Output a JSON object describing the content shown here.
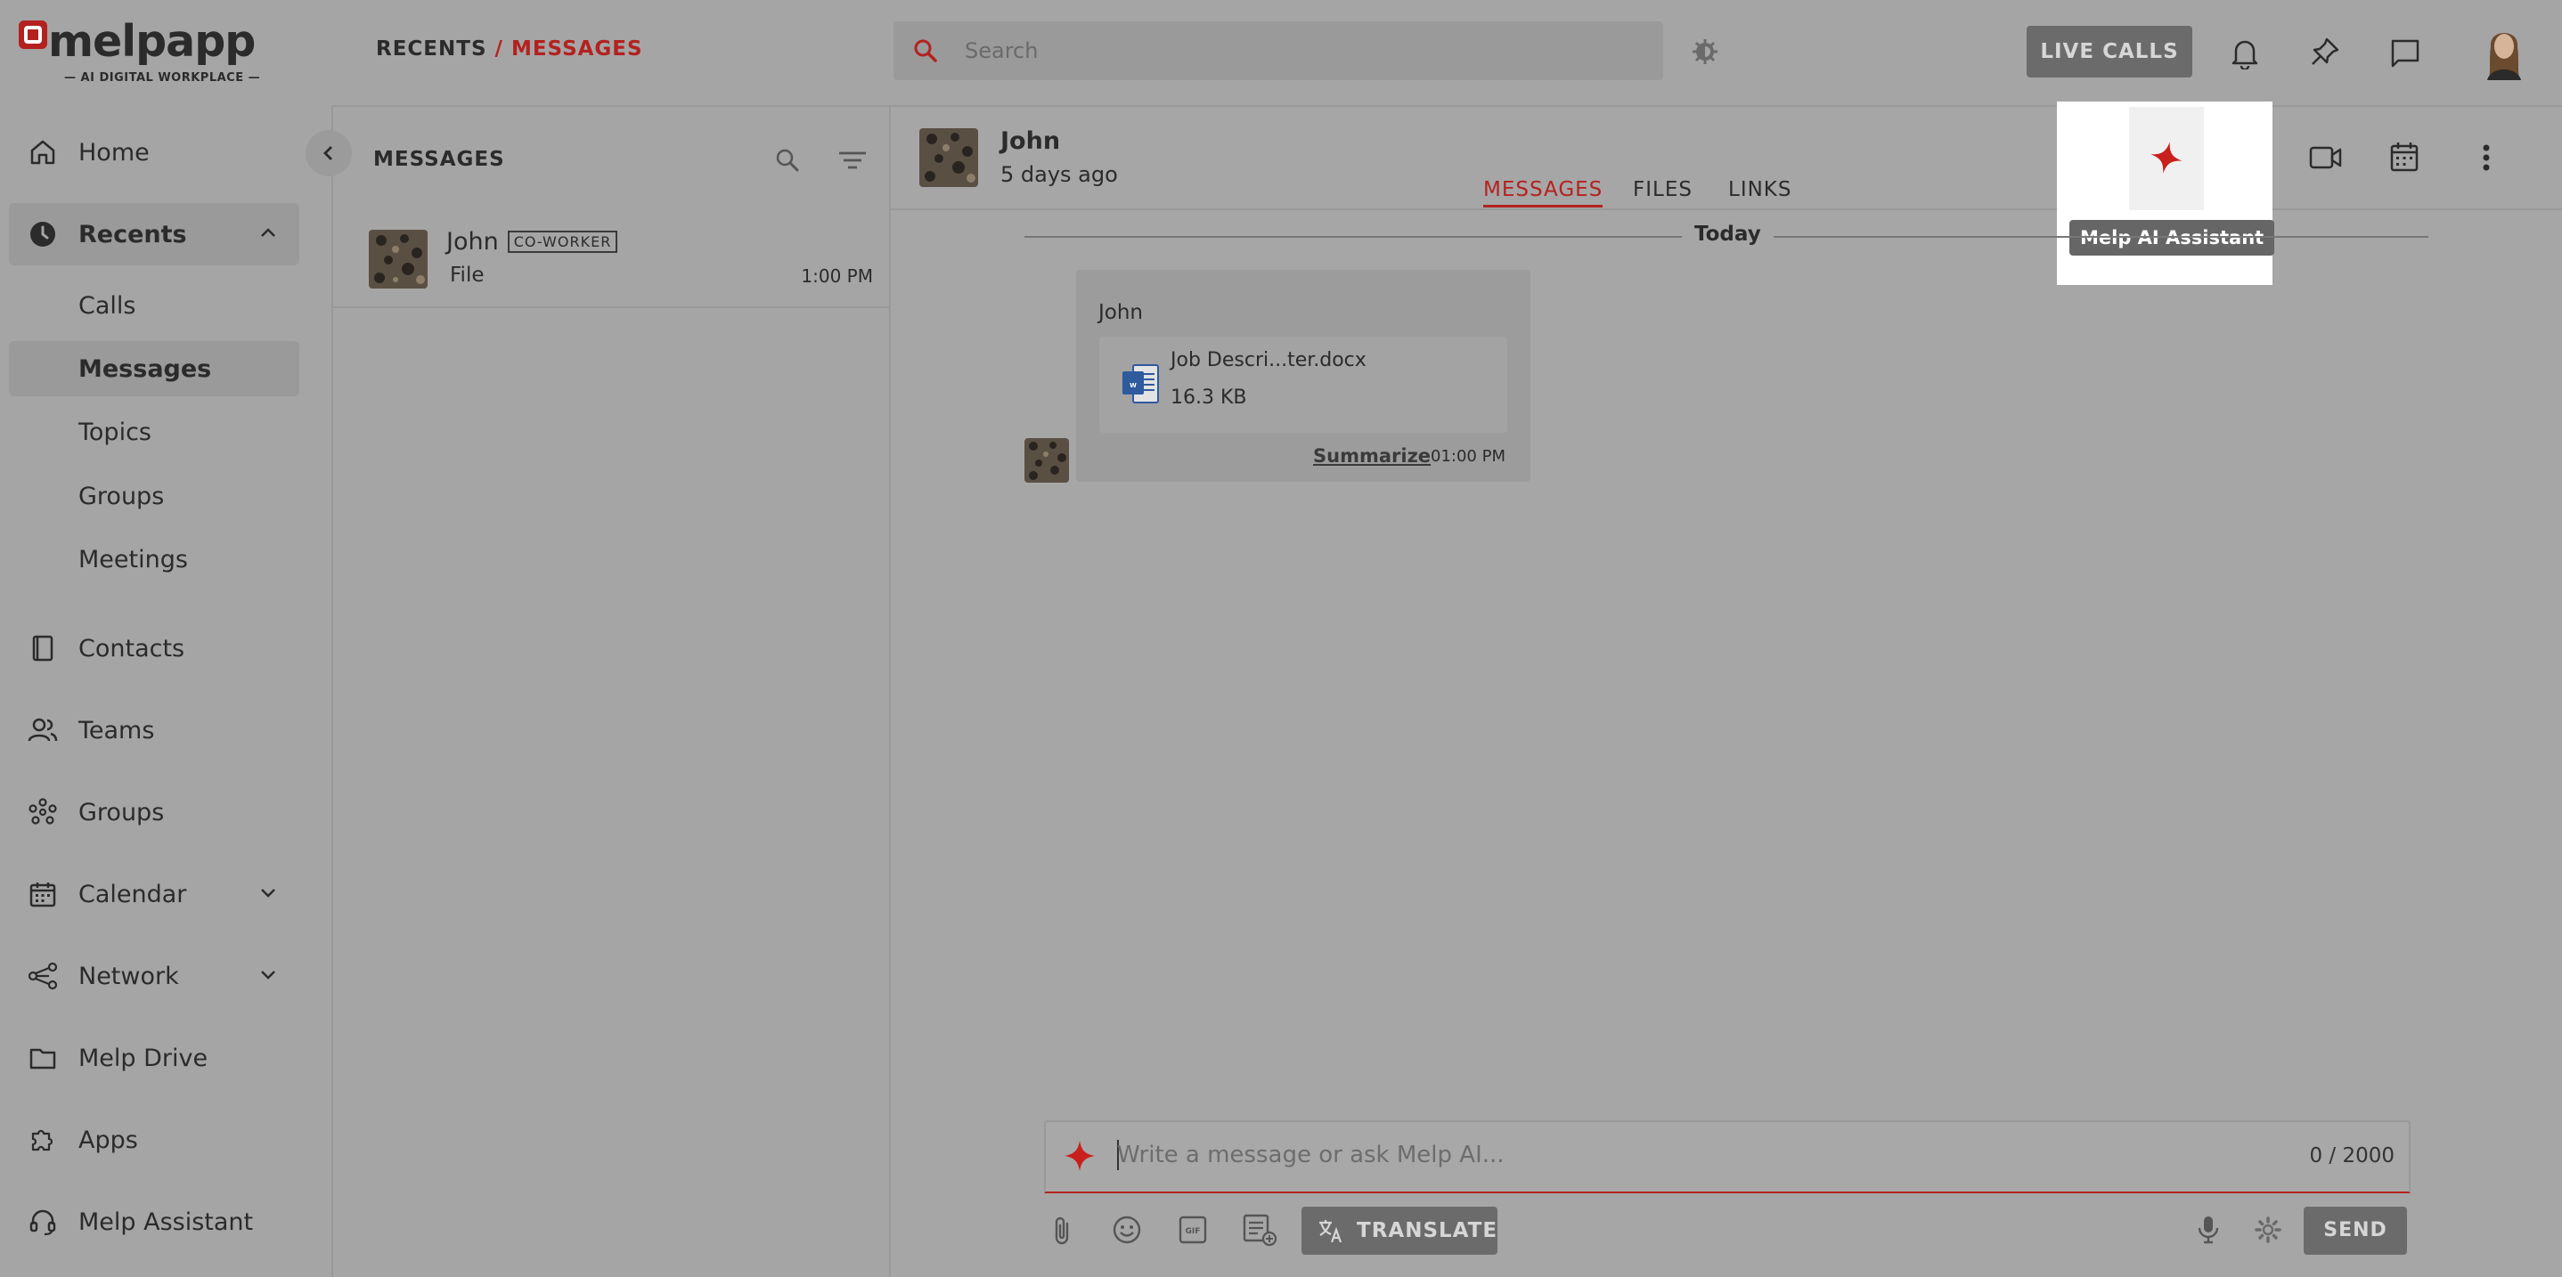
{
  "app": {
    "logo_text": "melpapp",
    "logo_tagline": "AI DIGITAL WORKPLACE"
  },
  "sidebar": {
    "items": [
      {
        "label": "Home",
        "icon": "home-icon"
      },
      {
        "label": "Recents",
        "icon": "clock-icon"
      },
      {
        "label": "Contacts",
        "icon": "contacts-icon"
      },
      {
        "label": "Teams",
        "icon": "teams-icon"
      },
      {
        "label": "Groups",
        "icon": "groups-icon"
      },
      {
        "label": "Calendar",
        "icon": "calendar-icon"
      },
      {
        "label": "Network",
        "icon": "network-icon"
      },
      {
        "label": "Melp Drive",
        "icon": "folder-icon"
      },
      {
        "label": "Apps",
        "icon": "puzzle-icon"
      },
      {
        "label": "Melp Assistant",
        "icon": "headset-icon"
      }
    ],
    "recents_sub": [
      "Calls",
      "Messages",
      "Topics",
      "Groups",
      "Meetings"
    ]
  },
  "header": {
    "breadcrumb_root": "RECENTS",
    "breadcrumb_sep": " / ",
    "breadcrumb_current": "MESSAGES",
    "search_placeholder": "Search",
    "live_calls_label": "LIVE CALLS"
  },
  "conversations": {
    "title": "MESSAGES",
    "items": [
      {
        "name": "John",
        "badge": "CO-WORKER",
        "preview": "File",
        "time": "1:00 PM"
      }
    ]
  },
  "chat": {
    "contact_name": "John",
    "last_seen": "5 days ago",
    "tabs": [
      "MESSAGES",
      "FILES",
      "LINKS"
    ],
    "active_tab": "MESSAGES",
    "day_separator": "Today",
    "message": {
      "sender": "John",
      "file_name": "Job Descri...ter.docx",
      "file_size": "16.3 KB",
      "summarize_label": "Summarize",
      "time": "01:00 PM"
    },
    "tooltip": "Melp AI Assistant",
    "compose": {
      "placeholder": "Write a message or ask Melp AI...",
      "counter": "0 / 2000",
      "translate_label": "TRANSLATE",
      "send_label": "SEND"
    }
  },
  "colors": {
    "accent": "#b3221f",
    "overlay_gray": "#a5a5a5",
    "button_dark": "#6b6b6b"
  }
}
